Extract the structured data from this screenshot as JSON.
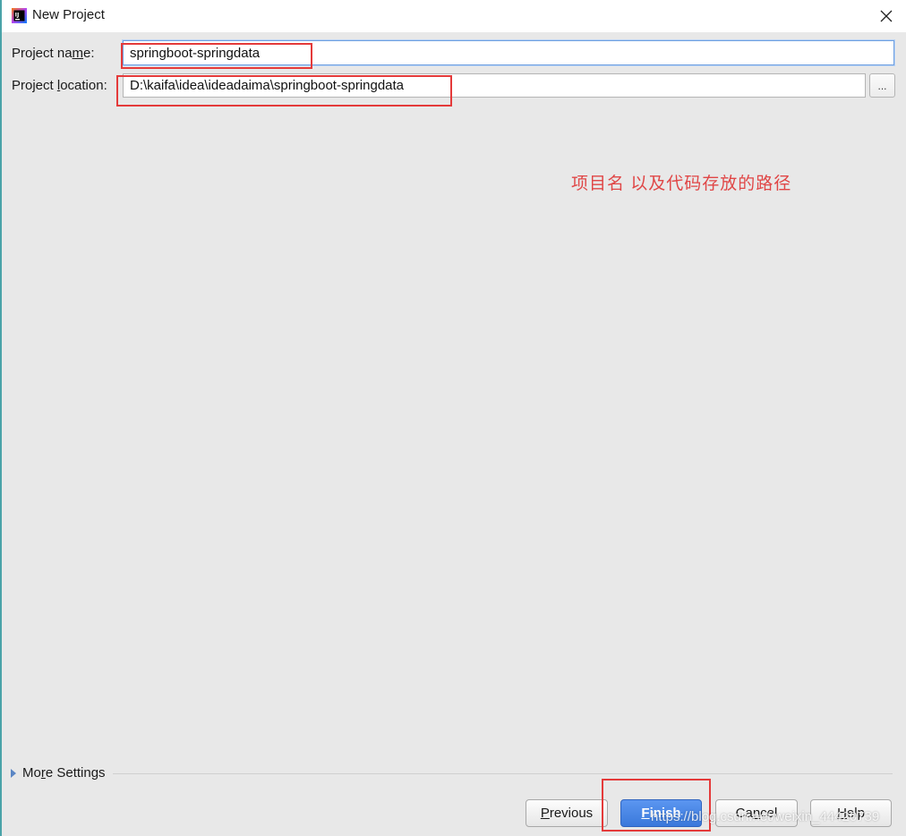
{
  "window": {
    "title": "New Project",
    "app_icon": "intellij-idea-icon",
    "close_icon": "close-icon"
  },
  "form": {
    "project_name_label_before": "Project na",
    "project_name_label_mnemonic": "m",
    "project_name_label_after": "e:",
    "project_name_value": "springboot-springdata",
    "project_location_label_before": "Project ",
    "project_location_label_mnemonic": "l",
    "project_location_label_after": "ocation:",
    "project_location_value": "D:\\kaifa\\idea\\ideadaima\\springboot-springdata",
    "browse_label": "..."
  },
  "annotation": {
    "text": "项目名  以及代码存放的路径",
    "color": "#e04646"
  },
  "more_settings": {
    "label_before": "Mo",
    "label_mnemonic": "r",
    "label_after": "e Settings"
  },
  "buttons": {
    "previous_mnemonic": "P",
    "previous_rest": "revious",
    "finish_mnemonic": "F",
    "finish_rest": "inish",
    "cancel_before": "Ca",
    "cancel_mnemonic": "n",
    "cancel_after": "cel",
    "help_mnemonic": "H",
    "help_rest": "elp"
  },
  "watermark": "https://blog.csdn.net/weixin_44420739",
  "colors": {
    "highlight_box": "#e43a3a",
    "primary_button": "#3a78db",
    "focus_border": "#6e9fe0"
  }
}
